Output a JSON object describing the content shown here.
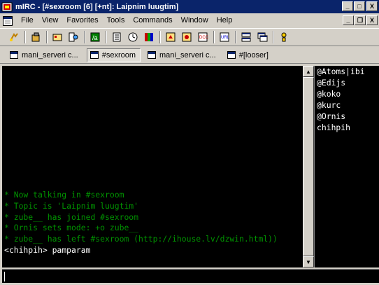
{
  "window": {
    "title": "mIRC - [#sexroom [6] [+nt]: Laipnim luugtim]",
    "minimize_label": "_",
    "maximize_label": "□",
    "close_label": "X"
  },
  "menubar": {
    "items": [
      "File",
      "View",
      "Favorites",
      "Tools",
      "Commands",
      "Window",
      "Help"
    ]
  },
  "toolbar": {
    "icons": [
      "connect-icon",
      "options-icon",
      "address-book-icon",
      "channels-list-icon",
      "script-editor-icon",
      "notify-list-icon",
      "timer-icon",
      "colors-icon",
      "dcc-send-icon",
      "dcc-chat-icon",
      "dcc-options-icon",
      "url-list-icon",
      "tile-icon",
      "cascade-icon",
      "help-icon"
    ]
  },
  "switchbar": {
    "tabs": [
      {
        "label": "mani_serveri c...",
        "active": false
      },
      {
        "label": "#sexroom",
        "active": true
      },
      {
        "label": "mani_serveri c...",
        "active": false
      },
      {
        "label": "#[looser]",
        "active": false
      }
    ]
  },
  "chat": {
    "lines": [
      {
        "text": "* Now talking in #sexroom",
        "kind": "event"
      },
      {
        "text": "* Topic is 'Laipnim luugtim'",
        "kind": "event"
      },
      {
        "text": "* zube__ has joined #sexroom",
        "kind": "event"
      },
      {
        "text": "* Ornis sets mode: +o zube__",
        "kind": "event"
      },
      {
        "text": "* zube__ has left #sexroom (http://ihouse.lv/dzwin.html))",
        "kind": "event"
      },
      {
        "text": "<chihpih> pamparam",
        "kind": "msg"
      }
    ]
  },
  "nicklist": {
    "nicks": [
      "@Atoms|ibi",
      "@Edijs",
      "@koko",
      "@kurc",
      "@Ornis",
      "chihpih"
    ]
  },
  "input": {
    "value": ""
  },
  "colors": {
    "titlebar": "#0a246a",
    "chat_background": "#000000",
    "event_text": "#009300",
    "message_text": "#ffffff"
  }
}
